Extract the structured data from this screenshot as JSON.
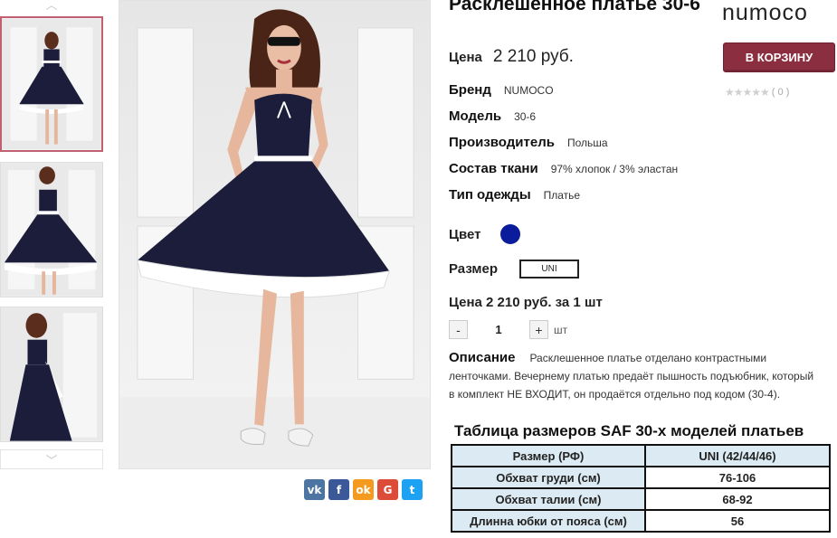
{
  "product": {
    "title": "Расклешенное платье 30-6",
    "price_label": "Цена",
    "price_value": "2 210 руб.",
    "attributes": [
      {
        "key": "Бренд",
        "value": "NUMOCO"
      },
      {
        "key": "Модель",
        "value": "30-6"
      },
      {
        "key": "Производитель",
        "value": "Польша"
      },
      {
        "key": "Состав ткани",
        "value": "97% хлопок / 3% эластан"
      },
      {
        "key": "Тип одежды",
        "value": "Платье"
      }
    ],
    "color_label": "Цвет",
    "color_hex": "#0a1c9c",
    "size_label": "Размер",
    "size_value": "UNI",
    "unit_price": "Цена 2 210 руб. за 1 шт",
    "quantity": {
      "minus": "-",
      "value": "1",
      "plus": "+",
      "unit": "шт"
    },
    "description_label": "Описание",
    "description": "Расклешенное платье отделано контрастными ленточками. Вечернему платью предаёт пышность подъюбник, который в комплект НЕ ВХОДИТ, он продаётся отдельно под кодом (30-4)."
  },
  "brand_logo": "numoco",
  "cart_button": "В КОРЗИНУ",
  "rating": {
    "stars": "★★★★★",
    "count": "( 0 )"
  },
  "thumbnails": {
    "up_arrow": "chevron-up-icon",
    "down_arrow": "chevron-down-icon",
    "items": [
      "thumb-1",
      "thumb-2",
      "thumb-3"
    ]
  },
  "social": [
    {
      "name": "vk",
      "glyph": "vk"
    },
    {
      "name": "facebook",
      "glyph": "f"
    },
    {
      "name": "odnoklassniki",
      "glyph": "ok"
    },
    {
      "name": "google",
      "glyph": "G"
    },
    {
      "name": "twitter",
      "glyph": "t"
    }
  ],
  "size_table": {
    "title": "Таблица размеров SAF 30-х моделей платьев",
    "header": [
      "Размер (РФ)",
      "UNI (42/44/46)"
    ],
    "rows": [
      [
        "Обхват груди (см)",
        "76-106"
      ],
      [
        "Обхват талии (см)",
        "68-92"
      ],
      [
        "Длинна юбки от пояса (см)",
        "56"
      ]
    ]
  },
  "colors": {
    "accent": "#8b2e3f",
    "table_header": "#dcebf3",
    "dress": "#1b1d3a"
  }
}
